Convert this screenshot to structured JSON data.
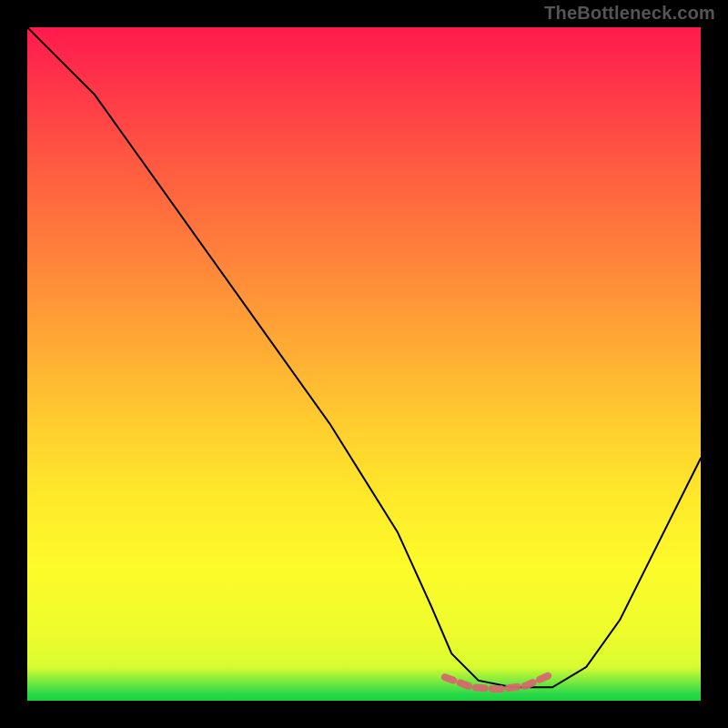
{
  "watermark_text": "TheBottleneck.com",
  "chart_data": {
    "type": "line",
    "title": "",
    "xlabel": "",
    "ylabel": "",
    "x_range": [
      0,
      1
    ],
    "y_range": [
      0,
      1
    ],
    "series": [
      {
        "name": "bottleneck-curve",
        "x": [
          0.0,
          0.03,
          0.06,
          0.1,
          0.15,
          0.2,
          0.25,
          0.3,
          0.35,
          0.4,
          0.45,
          0.5,
          0.55,
          0.6,
          0.63,
          0.67,
          0.72,
          0.78,
          0.83,
          0.88,
          0.93,
          1.0
        ],
        "y": [
          1.0,
          0.97,
          0.94,
          0.9,
          0.83,
          0.76,
          0.69,
          0.62,
          0.55,
          0.48,
          0.41,
          0.33,
          0.25,
          0.14,
          0.07,
          0.03,
          0.02,
          0.02,
          0.05,
          0.12,
          0.22,
          0.36
        ]
      }
    ],
    "annotations": [
      {
        "name": "valley-highlight",
        "type": "dashed-segment",
        "color": "#d46a6a",
        "x": [
          0.62,
          0.66,
          0.7,
          0.74,
          0.78
        ],
        "y": [
          0.035,
          0.02,
          0.017,
          0.022,
          0.04
        ]
      }
    ],
    "background": {
      "type": "vertical-gradient",
      "stops": [
        {
          "pos": 0.0,
          "color": "#ff1a4d"
        },
        {
          "pos": 0.5,
          "color": "#ffb233"
        },
        {
          "pos": 0.8,
          "color": "#fdfb2a"
        },
        {
          "pos": 0.99,
          "color": "#2bd94a"
        },
        {
          "pos": 1.0,
          "color": "#14d63e"
        }
      ]
    },
    "grid": false,
    "legend": false
  }
}
